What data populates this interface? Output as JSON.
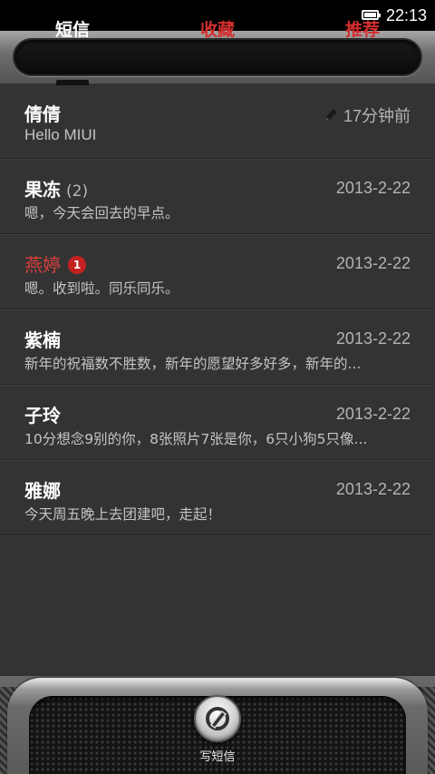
{
  "status": {
    "time": "22:13"
  },
  "tabs": [
    {
      "label": "短信"
    },
    {
      "label": "收藏"
    },
    {
      "label": "推荐"
    }
  ],
  "colors": {
    "accent_red": "#d42e2e",
    "badge_red": "#c42121",
    "background": "#333333"
  },
  "conversations": [
    {
      "name": "倩倩",
      "date": "17分钟前",
      "snippet": "Hello MIUI",
      "draft": true
    },
    {
      "name": "果冻",
      "count": "(2)",
      "date": "2013-2-22",
      "snippet": "嗯，今天会回去的早点。"
    },
    {
      "name": "燕婷",
      "badge": "1",
      "unread": true,
      "date": "2013-2-22",
      "snippet": "嗯。收到啦。同乐同乐。"
    },
    {
      "name": "紫楠",
      "date": "2013-2-22",
      "snippet": "新年的祝福数不胜数，新年的愿望好多好多，新年的..."
    },
    {
      "name": "子玲",
      "date": "2013-2-22",
      "snippet": "10分想念9别的你，8张照片7张是你，6只小狗5只像..."
    },
    {
      "name": "雅娜",
      "date": "2013-2-22",
      "snippet": "今天周五晚上去团建吧，走起！"
    }
  ],
  "compose": {
    "label": "写短信",
    "icon": "compose-icon"
  }
}
